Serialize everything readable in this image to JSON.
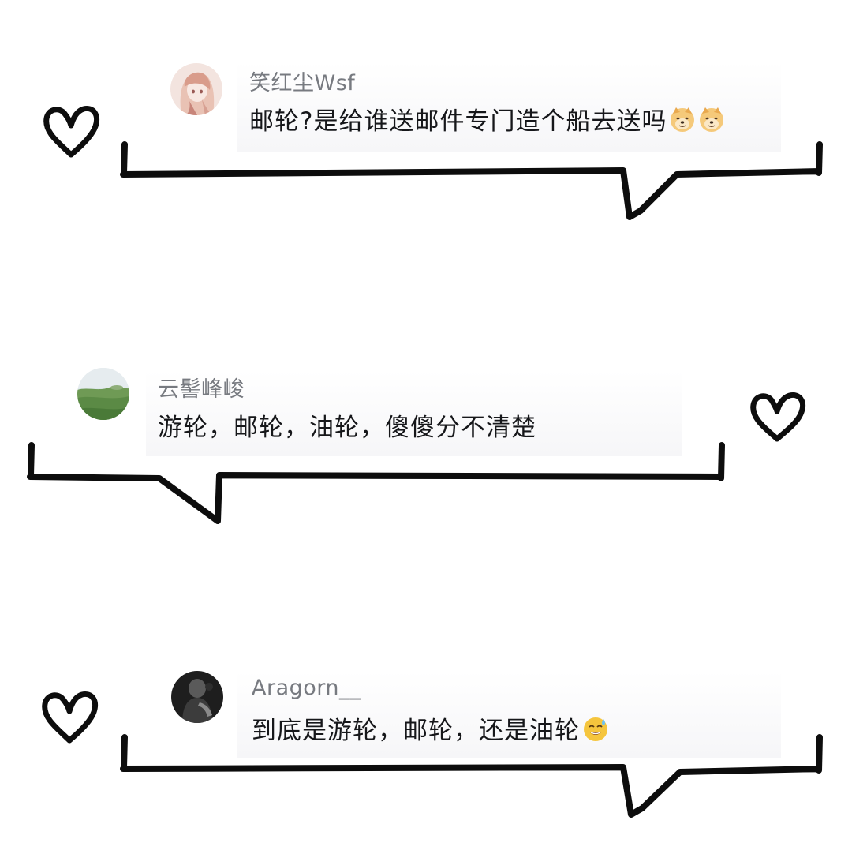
{
  "comments": [
    {
      "username": "笑红尘Wsf",
      "text": "邮轮?是给谁送邮件专门造个船去送吗",
      "emojis": [
        "doge-icon",
        "doge-icon"
      ],
      "avatar": "anime-girl-avatar"
    },
    {
      "username": "云髻峰峻",
      "text": "游轮，邮轮，油轮，傻傻分不清楚",
      "emojis": [],
      "avatar": "landscape-avatar"
    },
    {
      "username": "Aragorn__",
      "text": "到底是游轮，邮轮，还是油轮",
      "emojis": [
        "sweat-smile-icon"
      ],
      "avatar": "dark-photo-avatar"
    }
  ],
  "colors": {
    "username": "#777a80",
    "comment": "#16171a",
    "stroke": "#0d0d0d",
    "emoji": "#f5c53d"
  }
}
